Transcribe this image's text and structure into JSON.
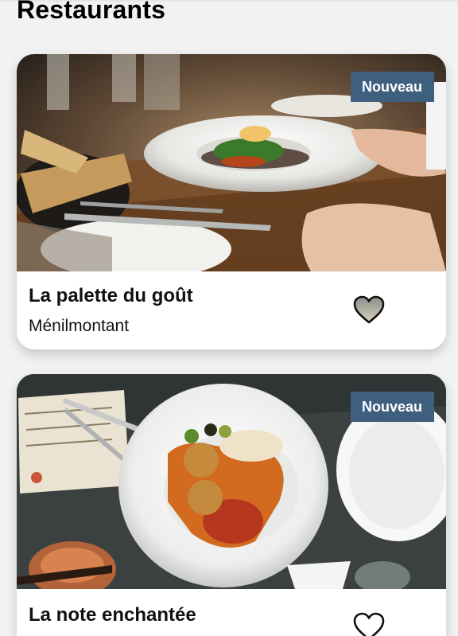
{
  "page": {
    "title": "Restaurants"
  },
  "restaurants": [
    {
      "badge": "Nouveau",
      "name": "La palette du goût",
      "location": "Ménilmontant",
      "favorite_icon": "heart-outline-icon"
    },
    {
      "badge": "Nouveau",
      "name": "La note enchantée",
      "location": "",
      "favorite_icon": "heart-outline-icon"
    }
  ],
  "colors": {
    "badge_background": "#3f5f7f",
    "page_background": "#f2f2f2",
    "card_background": "#ffffff"
  }
}
